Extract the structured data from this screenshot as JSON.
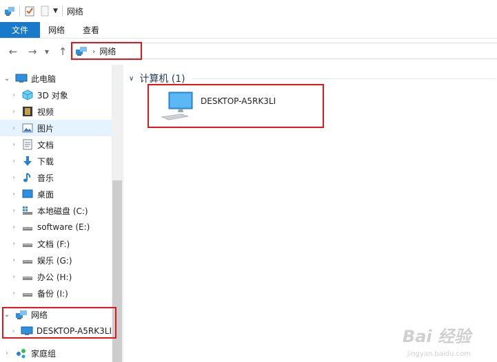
{
  "window": {
    "title": "网络"
  },
  "ribbon": {
    "tabs": [
      {
        "label": "文件"
      },
      {
        "label": "网络"
      },
      {
        "label": "查看"
      }
    ]
  },
  "address": {
    "crumbs": [
      "网络"
    ]
  },
  "sidebar": {
    "items": [
      {
        "label": "此电脑",
        "icon": "this-pc-icon"
      },
      {
        "label": "3D 对象",
        "icon": "3d-objects-icon"
      },
      {
        "label": "视频",
        "icon": "video-icon"
      },
      {
        "label": "图片",
        "icon": "pictures-icon"
      },
      {
        "label": "文档",
        "icon": "documents-icon"
      },
      {
        "label": "下载",
        "icon": "download-icon"
      },
      {
        "label": "音乐",
        "icon": "music-icon"
      },
      {
        "label": "桌面",
        "icon": "desktop-icon"
      },
      {
        "label": "本地磁盘 (C:)",
        "icon": "system-drive-icon"
      },
      {
        "label": "software (E:)",
        "icon": "drive-icon"
      },
      {
        "label": "文档 (F:)",
        "icon": "drive-icon"
      },
      {
        "label": "娱乐 (G:)",
        "icon": "drive-icon"
      },
      {
        "label": "办公 (H:)",
        "icon": "drive-icon"
      },
      {
        "label": "备份 (I:)",
        "icon": "drive-icon"
      },
      {
        "label": "网络",
        "icon": "network-icon"
      },
      {
        "label": "DESKTOP-A5RK3LI",
        "icon": "computer-icon"
      },
      {
        "label": "家庭组",
        "icon": "homegroup-icon"
      }
    ]
  },
  "main": {
    "group_title": "计算机 (1)",
    "items": [
      {
        "name": "DESKTOP-A5RK3LI",
        "icon": "computer-icon"
      }
    ]
  },
  "watermark": {
    "text": "Bai 经验",
    "sub": "jingyan.baidu.com"
  },
  "colors": {
    "accent": "#1979ca",
    "highlight": "#e3151a",
    "selected": "#e5f3ff",
    "group_text": "#1e395b"
  }
}
